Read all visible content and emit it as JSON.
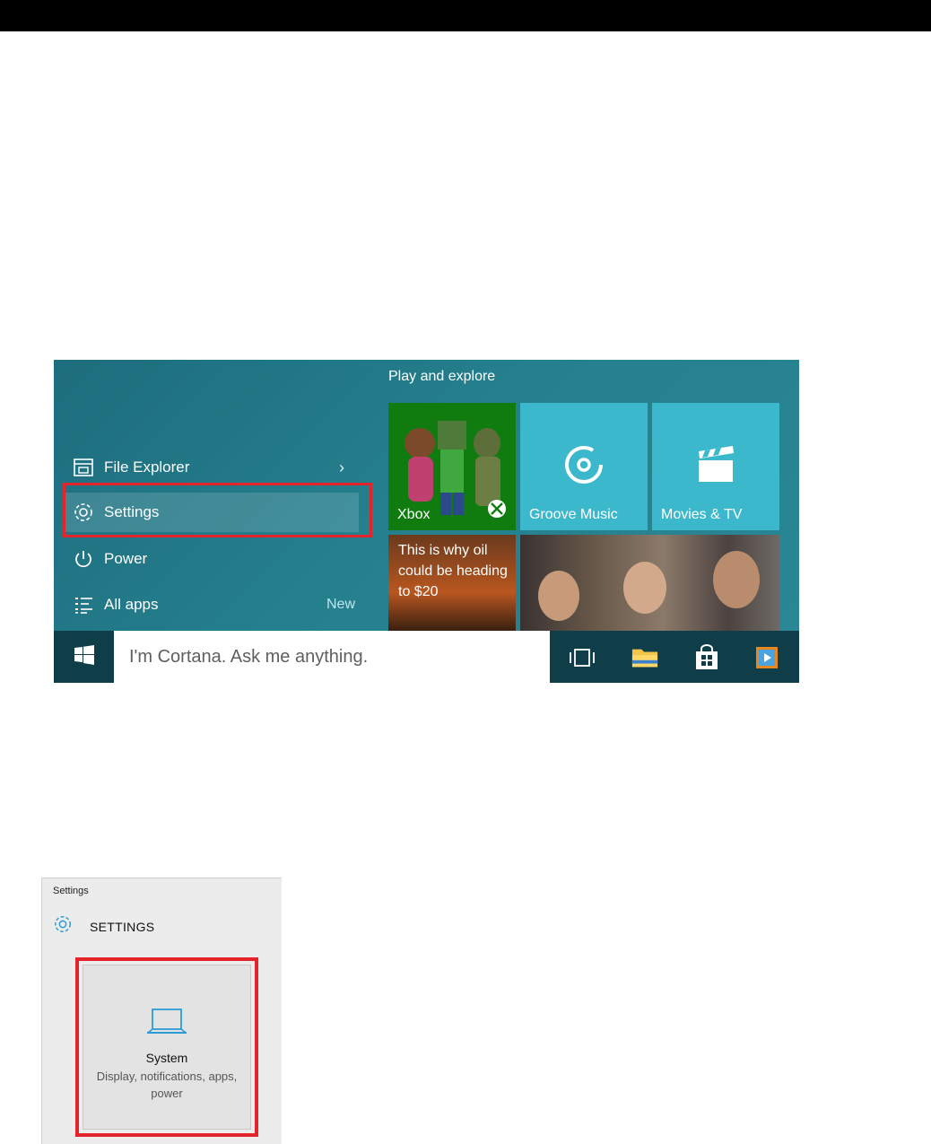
{
  "start_menu": {
    "section_title": "Play and explore",
    "items": [
      {
        "label": "File Explorer",
        "icon": "file-explorer-icon",
        "chevron": "›"
      },
      {
        "label": "Settings",
        "icon": "gear-icon"
      },
      {
        "label": "Power",
        "icon": "power-icon"
      },
      {
        "label": "All apps",
        "icon": "list-icon",
        "badge": "New"
      }
    ],
    "tiles": [
      {
        "label": "Xbox",
        "icon": "xbox-icon"
      },
      {
        "label": "Groove Music",
        "icon": "groove-music-icon"
      },
      {
        "label": "Movies & TV",
        "icon": "clapperboard-icon"
      },
      {
        "headline": "This is why oil could be heading to $20"
      }
    ]
  },
  "taskbar": {
    "search_placeholder": "I'm Cortana. Ask me anything.",
    "icons": [
      "windows-logo-icon",
      "task-view-icon",
      "folder-icon",
      "store-icon",
      "media-player-icon"
    ]
  },
  "settings_window": {
    "window_title": "Settings",
    "header": "SETTINGS",
    "tile": {
      "title": "System",
      "description": "Display, notifications, apps, power",
      "icon": "laptop-icon"
    }
  },
  "colors": {
    "accent": "#3bb8cc",
    "highlight": "#e3242b",
    "xbox_green": "#107c10"
  }
}
